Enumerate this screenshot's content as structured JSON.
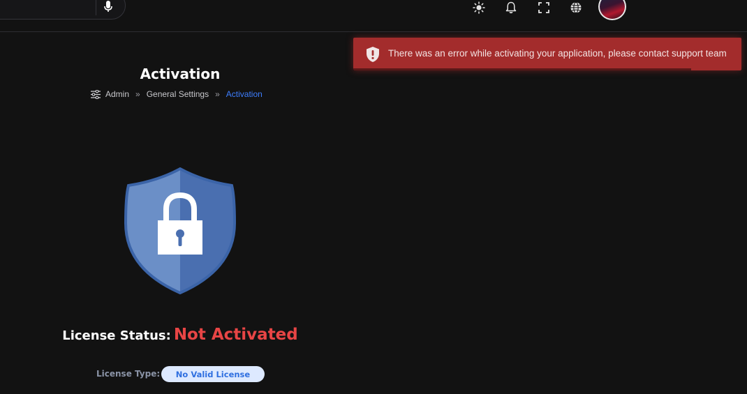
{
  "theme": {
    "background": "#121212",
    "error_toast": "#a32c2c",
    "danger_text": "#e84545",
    "link_blue": "#3d7eff",
    "shield_light": "#6b8fc7",
    "shield_dark": "#4a6fb0"
  },
  "topbar": {
    "search": {
      "placeholder": "",
      "mic_icon": "microphone-icon"
    },
    "icons": [
      "sun-icon",
      "bell-icon",
      "fullscreen-icon",
      "globe-icon"
    ],
    "avatar": "user-avatar"
  },
  "toast": {
    "icon": "shield-alert-icon",
    "message": "There was an error while activating your application, please contact support team",
    "progress_fraction": 0.87
  },
  "page": {
    "title": "Activation",
    "breadcrumb": {
      "icon": "sliders-icon",
      "items": [
        "Admin",
        "General Settings",
        "Activation"
      ],
      "separator": "»"
    }
  },
  "license": {
    "status_label": "License Status:",
    "status_value": "Not Activated",
    "type_label": "License Type:",
    "type_value": "No Valid License"
  }
}
